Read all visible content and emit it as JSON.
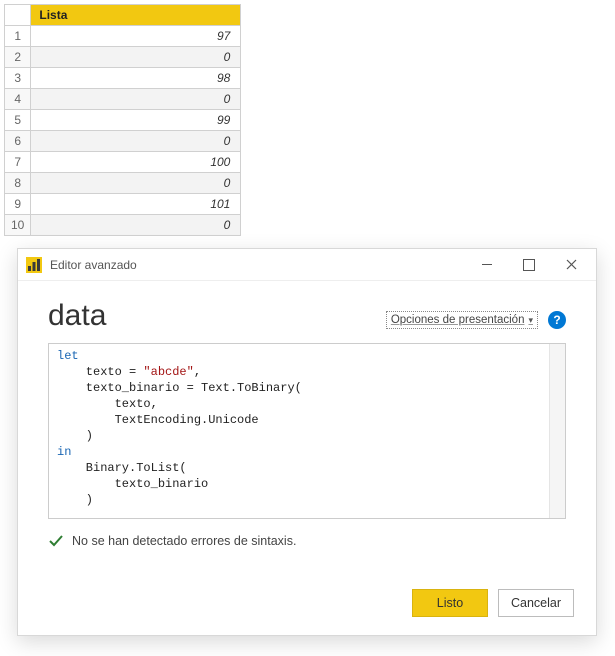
{
  "table": {
    "header": "Lista",
    "rows": [
      {
        "n": "1",
        "v": "97"
      },
      {
        "n": "2",
        "v": "0"
      },
      {
        "n": "3",
        "v": "98"
      },
      {
        "n": "4",
        "v": "0"
      },
      {
        "n": "5",
        "v": "99"
      },
      {
        "n": "6",
        "v": "0"
      },
      {
        "n": "7",
        "v": "100"
      },
      {
        "n": "8",
        "v": "0"
      },
      {
        "n": "9",
        "v": "101"
      },
      {
        "n": "10",
        "v": "0"
      }
    ]
  },
  "dialog": {
    "window_title": "Editor avanzado",
    "heading": "data",
    "options_label": "Opciones de presentación",
    "help_glyph": "?",
    "code": {
      "l0_kw": "let",
      "l1": "    texto = ",
      "l1_str": "\"abcde\"",
      "l1b": ",",
      "l2": "    texto_binario = Text.ToBinary(",
      "l3": "        texto,",
      "l4": "        TextEncoding.Unicode",
      "l5": "    )",
      "l6_kw": "in",
      "l7": "    Binary.ToList(",
      "l8": "        texto_binario",
      "l9": "    )"
    },
    "status_text": "No se han detectado errores de sintaxis.",
    "buttons": {
      "done": "Listo",
      "cancel": "Cancelar"
    }
  }
}
